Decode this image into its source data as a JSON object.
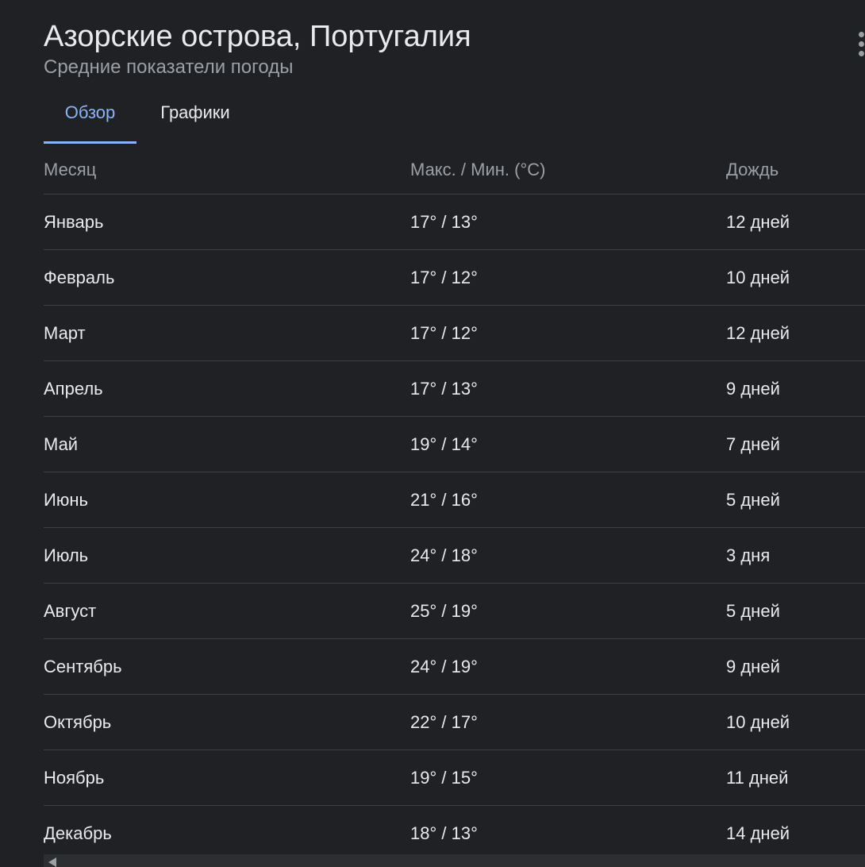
{
  "header": {
    "title": "Азорские острова, Португалия",
    "subtitle": "Средние показатели погоды"
  },
  "tabs": [
    {
      "label": "Обзор",
      "active": true
    },
    {
      "label": "Графики",
      "active": false
    }
  ],
  "table": {
    "columns": [
      "Месяц",
      "Макс. / Мин. (°C)",
      "Дождь"
    ],
    "rows": [
      [
        "Январь",
        "17° / 13°",
        "12 дней"
      ],
      [
        "Февраль",
        "17° / 12°",
        "10 дней"
      ],
      [
        "Март",
        "17° / 12°",
        "12 дней"
      ],
      [
        "Апрель",
        "17° / 13°",
        "9 дней"
      ],
      [
        "Май",
        "19° / 14°",
        "7 дней"
      ],
      [
        "Июнь",
        "21° / 16°",
        "5 дней"
      ],
      [
        "Июль",
        "24° / 18°",
        "3 дня"
      ],
      [
        "Август",
        "25° / 19°",
        "5 дней"
      ],
      [
        "Сентябрь",
        "24° / 19°",
        "9 дней"
      ],
      [
        "Октябрь",
        "22° / 17°",
        "10 дней"
      ],
      [
        "Ноябрь",
        "19° / 15°",
        "11 дней"
      ],
      [
        "Декабрь",
        "18° / 13°",
        "14 дней"
      ]
    ]
  },
  "icons": {
    "menu": "more-vert-icon",
    "scroll_left": "scroll-left-arrow-icon"
  },
  "colors": {
    "background": "#202124",
    "text": "#e8eaed",
    "muted": "#9aa0a6",
    "accent": "#8ab4f8",
    "divider": "#3c4043"
  }
}
